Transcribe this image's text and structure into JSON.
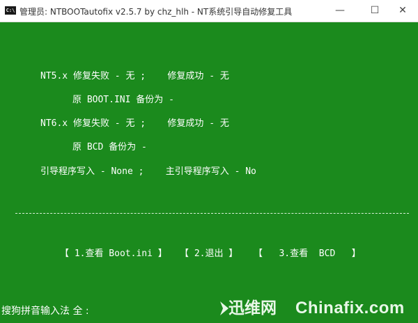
{
  "window": {
    "icon_label": "C:\\",
    "title": "管理员:  NTBOOTautofix v2.5.7 by chz_hlh - NT系统引导自动修复工具",
    "minimize_glyph": "—",
    "maximize_glyph": "☐",
    "close_glyph": "✕"
  },
  "console": {
    "nt5_status": "NT5.x 修复失败 - 无 ;    修复成功 - 无",
    "nt5_backup": "原 BOOT.INI 备份为 -",
    "nt6_status": "NT6.x 修复失败 - 无 ;    修复成功 - 无",
    "nt6_backup": "原 BCD 备份为 -",
    "boot_write": "引导程序写入 - None ;    主引导程序写入 - No",
    "menu": [
      "【 1.查看 Boot.ini 】",
      "【 2.退出 】",
      "【   3.查看  BCD   】"
    ],
    "ime_status": "搜狗拼音输入法 全 :"
  },
  "watermark": {
    "left_text": "迅维网",
    "right_text": "Chinafix.com"
  },
  "colors": {
    "console_bg": "#1b8a1d",
    "console_fg": "#ffffff",
    "titlebar_bg": "#ffffff"
  }
}
